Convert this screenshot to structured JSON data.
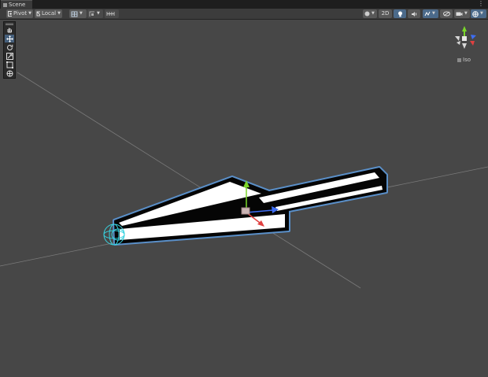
{
  "tab": {
    "title": "Scene",
    "icon": "scene-grid-icon"
  },
  "toolbar": {
    "pivot_label": "Pivot",
    "local_label": "Local",
    "toggle_2d_label": "2D"
  },
  "tools": {
    "items": [
      "hand-tool-icon",
      "move-tool-icon",
      "rotate-tool-icon",
      "scale-tool-icon",
      "rect-tool-icon",
      "transform-tool-icon"
    ],
    "active": "move-tool-icon"
  },
  "gizmo": {
    "iso_label": "Iso"
  },
  "colors": {
    "background": "#474747",
    "toolbar": "#3c3c3c",
    "accent": "#4b6a8a",
    "selection_outline": "#5a8fc8",
    "axis_x": "#e04040",
    "axis_y": "#7ad62a",
    "axis_z": "#3d6df2"
  }
}
